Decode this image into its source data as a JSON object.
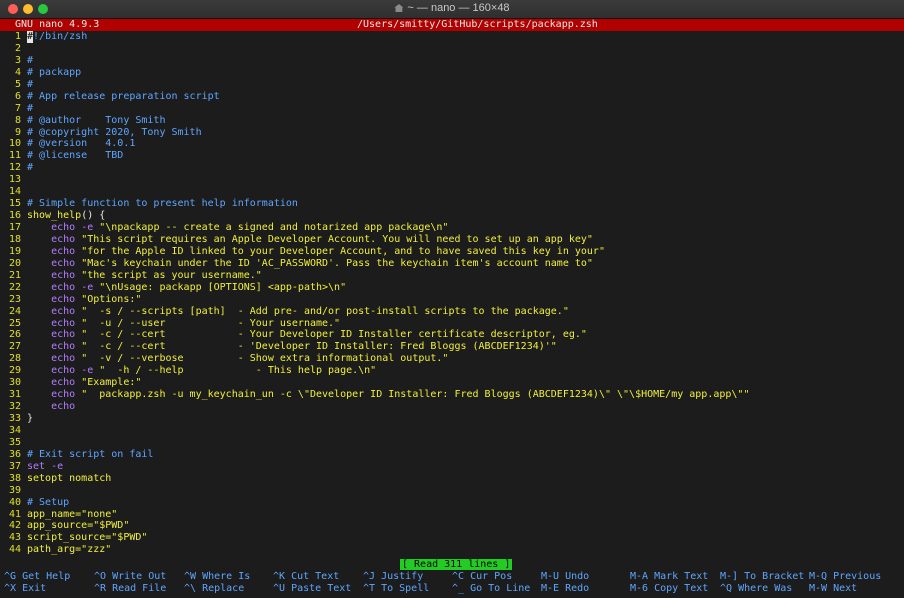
{
  "window": {
    "title": "~ — nano — 160×48"
  },
  "header": {
    "version": "GNU nano 4.9.3",
    "filepath": "/Users/smitty/GitHub/scripts/packapp.zsh"
  },
  "lines": [
    [
      {
        "t": "!/bin/zsh",
        "c": "comment",
        "cursor": "#"
      }
    ],
    [],
    [
      {
        "t": "#",
        "c": "comment"
      }
    ],
    [
      {
        "t": "# packapp",
        "c": "comment"
      }
    ],
    [
      {
        "t": "#",
        "c": "comment"
      }
    ],
    [
      {
        "t": "# App release preparation script",
        "c": "comment"
      }
    ],
    [
      {
        "t": "#",
        "c": "comment"
      }
    ],
    [
      {
        "t": "# @author    Tony Smith",
        "c": "comment"
      }
    ],
    [
      {
        "t": "# @copyright 2020, Tony Smith",
        "c": "comment"
      }
    ],
    [
      {
        "t": "# @version   4.0.1",
        "c": "comment"
      }
    ],
    [
      {
        "t": "# @license   TBD",
        "c": "comment"
      }
    ],
    [
      {
        "t": "#",
        "c": "comment"
      }
    ],
    [],
    [],
    [
      {
        "t": "# Simple function to present help information",
        "c": "comment"
      }
    ],
    [
      {
        "t": "show_help",
        "c": "func"
      },
      {
        "t": "() {",
        "c": "plain"
      }
    ],
    [
      {
        "t": "    echo ",
        "c": "echo"
      },
      {
        "t": "-e",
        "c": "flag"
      },
      {
        "t": " \"\\npackapp -- create a signed and notarized app package\\n\"",
        "c": "str"
      }
    ],
    [
      {
        "t": "    echo ",
        "c": "echo"
      },
      {
        "t": "\"This script requires an Apple Developer Account. You will need to set up an app key\"",
        "c": "str"
      }
    ],
    [
      {
        "t": "    echo ",
        "c": "echo"
      },
      {
        "t": "\"for the Apple ID linked to your Developer Account, and to have saved this key in your\"",
        "c": "str"
      }
    ],
    [
      {
        "t": "    echo ",
        "c": "echo"
      },
      {
        "t": "\"Mac's keychain under the ID 'AC_PASSWORD'. Pass the keychain item's account name to\"",
        "c": "str"
      }
    ],
    [
      {
        "t": "    echo ",
        "c": "echo"
      },
      {
        "t": "\"the script as your username.\"",
        "c": "str"
      }
    ],
    [
      {
        "t": "    echo ",
        "c": "echo"
      },
      {
        "t": "-e",
        "c": "flag"
      },
      {
        "t": " \"\\nUsage: packapp [OPTIONS] <app-path>\\n\"",
        "c": "str"
      }
    ],
    [
      {
        "t": "    echo ",
        "c": "echo"
      },
      {
        "t": "\"Options:\"",
        "c": "str"
      }
    ],
    [
      {
        "t": "    echo ",
        "c": "echo"
      },
      {
        "t": "\"  -s / --scripts [path]  - Add pre- and/or post-install scripts to the package.\"",
        "c": "str"
      }
    ],
    [
      {
        "t": "    echo ",
        "c": "echo"
      },
      {
        "t": "\"  -u / --user            - Your username.\"",
        "c": "str"
      }
    ],
    [
      {
        "t": "    echo ",
        "c": "echo"
      },
      {
        "t": "\"  -c / --cert            - Your Developer ID Installer certificate descriptor, eg.\"",
        "c": "str"
      }
    ],
    [
      {
        "t": "    echo ",
        "c": "echo"
      },
      {
        "t": "\"  -c / --cert            - 'Developer ID Installer: Fred Bloggs (ABCDEF1234)'\"",
        "c": "str"
      }
    ],
    [
      {
        "t": "    echo ",
        "c": "echo"
      },
      {
        "t": "\"  -v / --verbose         - Show extra informational output.\"",
        "c": "str"
      }
    ],
    [
      {
        "t": "    echo ",
        "c": "echo"
      },
      {
        "t": "-e",
        "c": "flag"
      },
      {
        "t": " \"  -h / --help            - This help page.\\n\"",
        "c": "str"
      }
    ],
    [
      {
        "t": "    echo ",
        "c": "echo"
      },
      {
        "t": "\"Example:\"",
        "c": "str"
      }
    ],
    [
      {
        "t": "    echo ",
        "c": "echo"
      },
      {
        "t": "\"  packapp.zsh -u my_keychain_un -c \\\"Developer ID Installer: Fred Bloggs (ABCDEF1234)\\\" \\\"\\$HOME/my app.app\\\"\"",
        "c": "str"
      }
    ],
    [
      {
        "t": "    echo",
        "c": "echo"
      }
    ],
    [
      {
        "t": "}",
        "c": "plain"
      }
    ],
    [],
    [],
    [
      {
        "t": "# Exit script on fail",
        "c": "comment"
      }
    ],
    [
      {
        "t": "set ",
        "c": "echo"
      },
      {
        "t": "-e",
        "c": "flag"
      }
    ],
    [
      {
        "t": "setopt nomatch",
        "c": "green"
      }
    ],
    [],
    [
      {
        "t": "# Setup",
        "c": "comment"
      }
    ],
    [
      {
        "t": "app_name=\"none\"",
        "c": "green"
      }
    ],
    [
      {
        "t": "app_source=\"$PWD\"",
        "c": "green"
      }
    ],
    [
      {
        "t": "script_source=\"$PWD\"",
        "c": "green"
      }
    ],
    [
      {
        "t": "path_arg=\"zzz\"",
        "c": "green"
      }
    ]
  ],
  "status": {
    "message": "[ Read 311 lines ]"
  },
  "shortcuts": {
    "row1": [
      {
        "key": "^G",
        "label": "Get Help"
      },
      {
        "key": "^O",
        "label": "Write Out"
      },
      {
        "key": "^W",
        "label": "Where Is"
      },
      {
        "key": "^K",
        "label": "Cut Text"
      },
      {
        "key": "^J",
        "label": "Justify"
      },
      {
        "key": "^C",
        "label": "Cur Pos"
      },
      {
        "key": "M-U",
        "label": "Undo"
      },
      {
        "key": "M-A",
        "label": "Mark Text"
      },
      {
        "key": "M-]",
        "label": "To Bracket"
      },
      {
        "key": "M-Q",
        "label": "Previous"
      }
    ],
    "row2": [
      {
        "key": "^X",
        "label": "Exit"
      },
      {
        "key": "^R",
        "label": "Read File"
      },
      {
        "key": "^\\",
        "label": "Replace"
      },
      {
        "key": "^U",
        "label": "Paste Text"
      },
      {
        "key": "^T",
        "label": "To Spell"
      },
      {
        "key": "^_",
        "label": "Go To Line"
      },
      {
        "key": "M-E",
        "label": "Redo"
      },
      {
        "key": "M-6",
        "label": "Copy Text"
      },
      {
        "key": "^Q",
        "label": "Where Was"
      },
      {
        "key": "M-W",
        "label": "Next"
      }
    ]
  }
}
